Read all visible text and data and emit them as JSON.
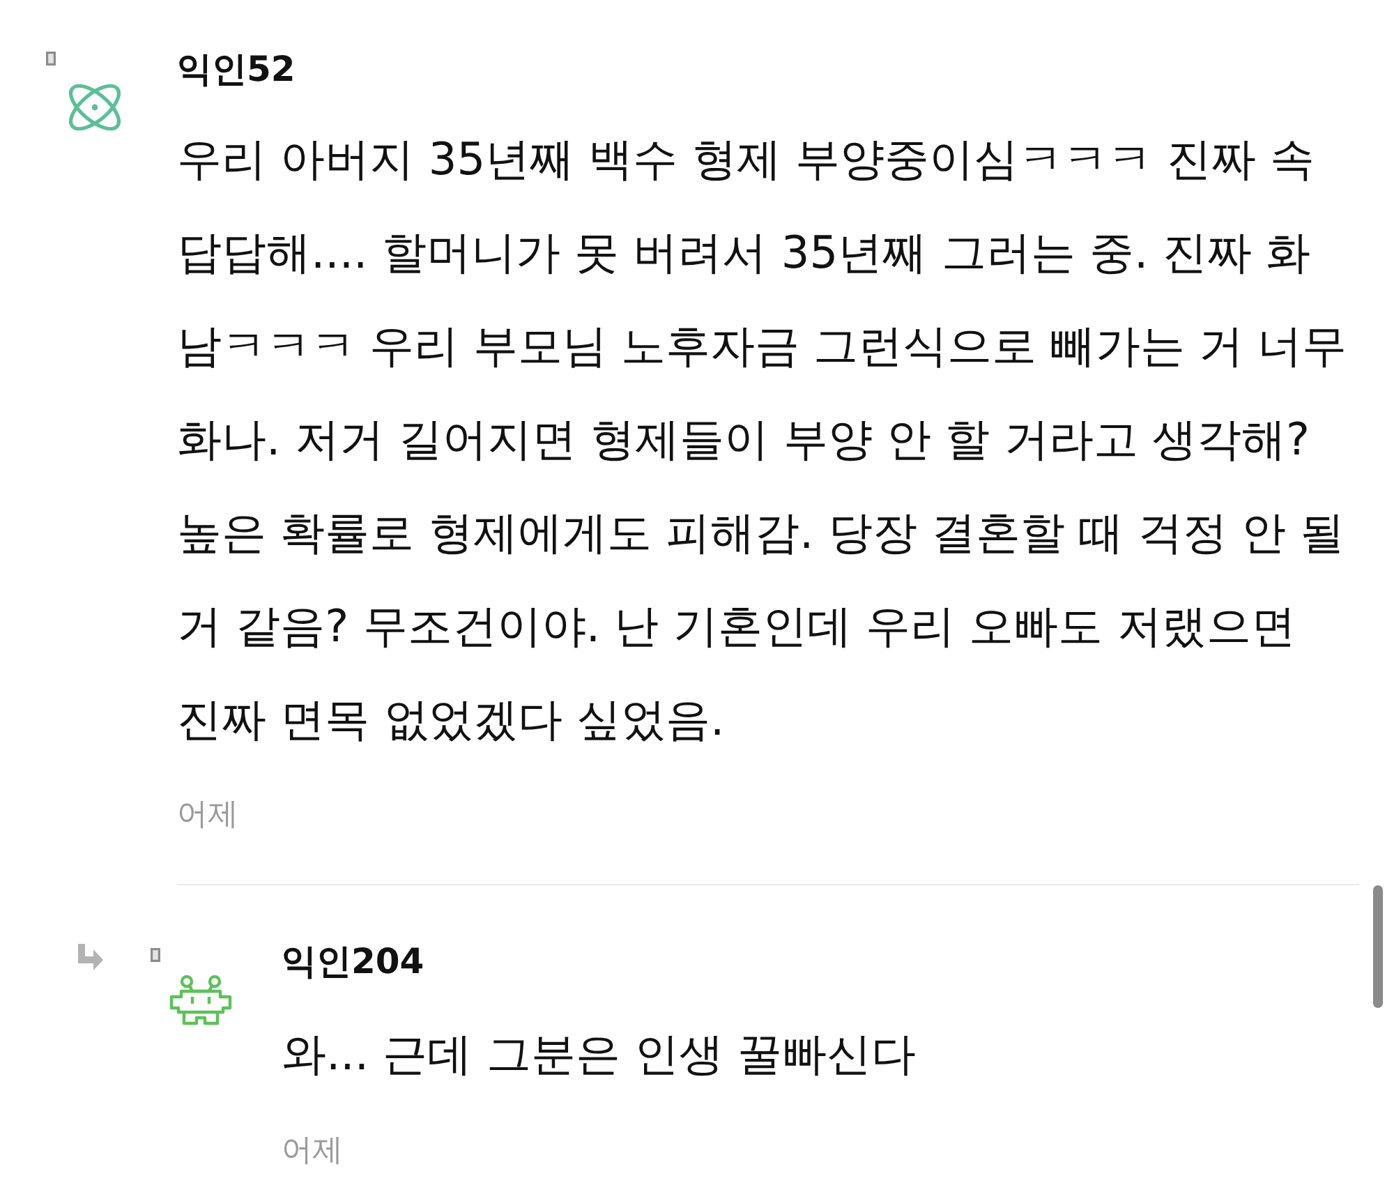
{
  "comments": [
    {
      "author": "익인52",
      "text": "우리 아버지 35년째 백수 형제 부양중이심ㅋㅋㅋ 진짜 속 답답해.... 할머니가 못 버려서 35년째 그러는 중. 진짜 화 남ㅋㅋㅋ 우리 부모님 노후자금 그런식으로 빼가는 거 너무 화나. 저거 길어지면 형제들이 부양 안 할 거라고 생각해? 높은 확률로 형제에게도 피해감. 당장 결혼할 때 걱정 안 될 거 같음? 무조건이야. 난 기혼인데 우리 오빠도 저랬으면 진짜 면목 없었겠다 싶었음.",
      "time": "어제",
      "replies": [
        {
          "author": "익인204",
          "text": "와... 근데 그분은 인생 꿀빠신다",
          "time": "어제"
        }
      ]
    }
  ]
}
